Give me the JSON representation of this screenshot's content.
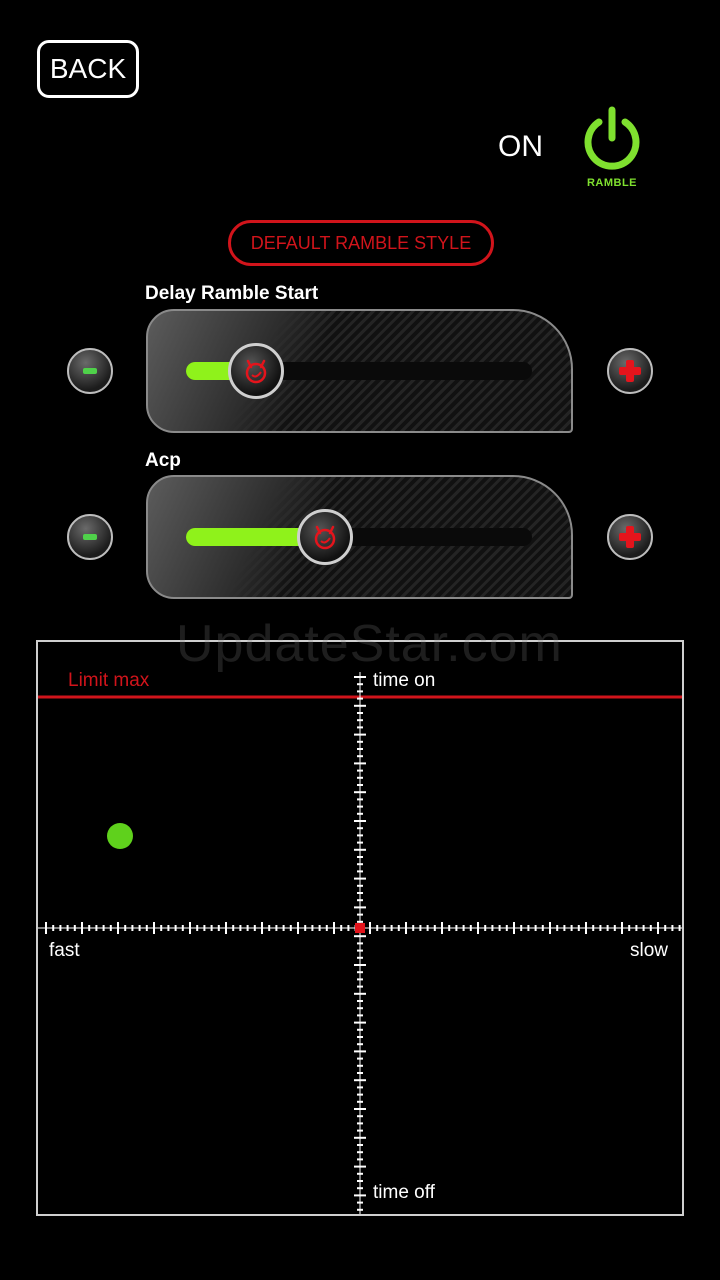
{
  "header": {
    "back_label": "BACK"
  },
  "power": {
    "status_text": "ON",
    "label": "RAMBLE",
    "color": "#7fe02f"
  },
  "style_button": {
    "label": "DEFAULT RAMBLE STYLE",
    "color": "#d1141b"
  },
  "sliders": [
    {
      "label": "Delay Ramble Start",
      "value_fraction": 0.2
    },
    {
      "label": "Acp",
      "value_fraction": 0.4
    }
  ],
  "graph": {
    "limit_label": "Limit max",
    "top_label": "time on",
    "bottom_label": "time off",
    "left_label": "fast",
    "right_label": "slow",
    "limit_color": "#d1141b",
    "dot_color": "#5fd11c"
  },
  "watermark": "UpdateStar.com",
  "colors": {
    "accent_green": "#8ff21b",
    "accent_red": "#e4141c",
    "background": "#000000"
  }
}
